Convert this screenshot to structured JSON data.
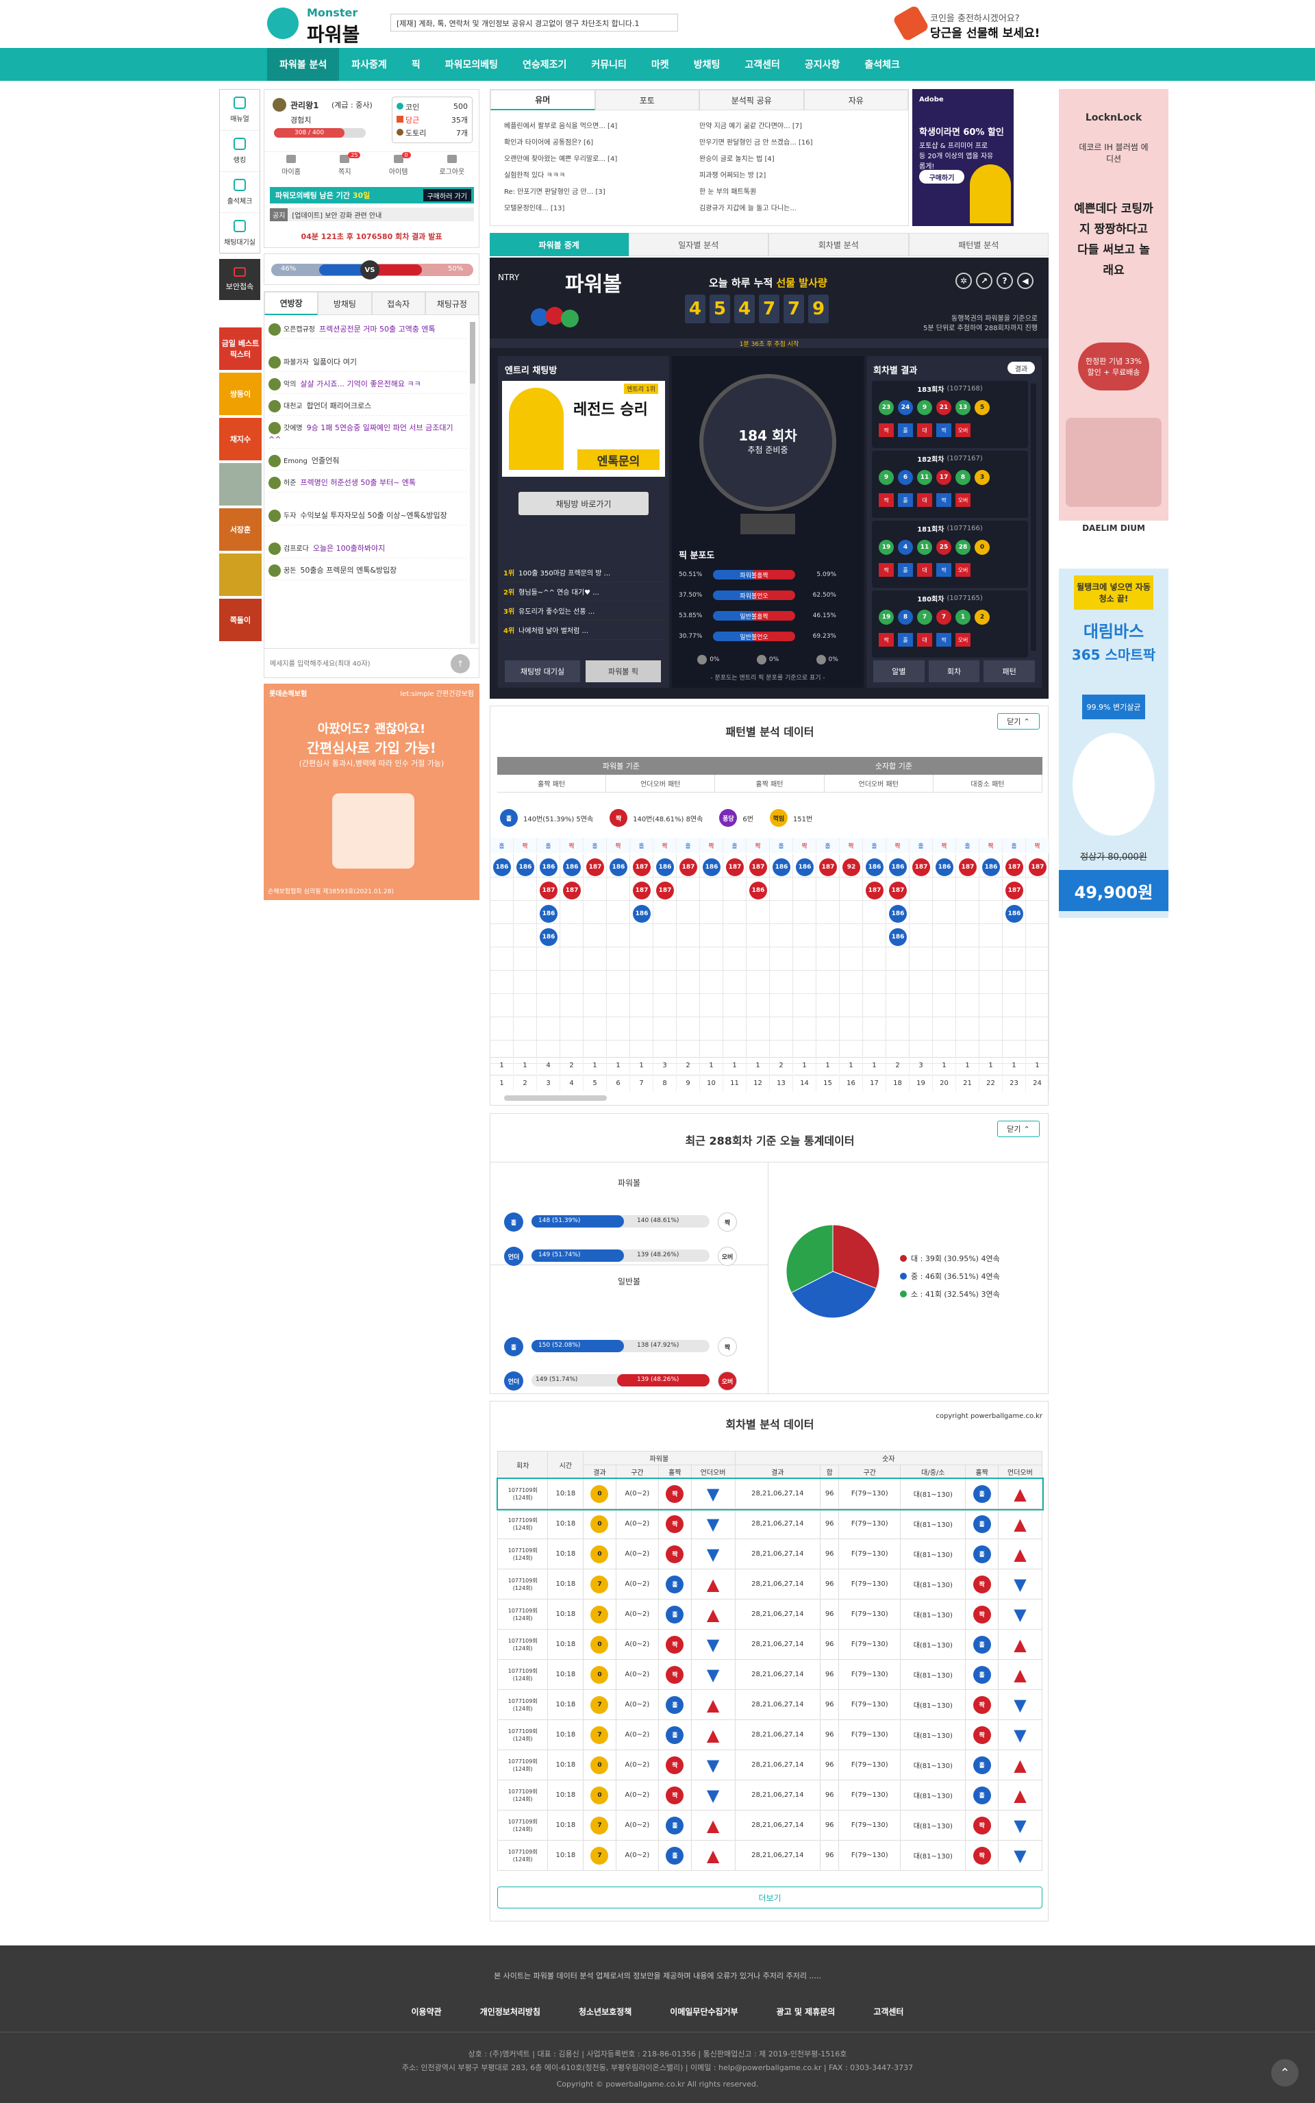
{
  "header": {
    "logo_small": "Monster",
    "logo_big": "파워볼",
    "notice": "[제재] 계좌, 톡, 연락처 및 개인정보 공유시 경고없이 영구 차단조치 합니다.1",
    "coin_line1": "코인을 충전하시겠어요?",
    "coin_line2": "당근을 선물해 보세요!"
  },
  "nav": [
    "파워볼 분석",
    "파사중계",
    "픽",
    "파워모의베팅",
    "연승제조기",
    "커뮤니티",
    "마켓",
    "방채팅",
    "고객센터",
    "공지사항",
    "출석체크"
  ],
  "sidebar_left": {
    "items": [
      "매뉴얼",
      "랭킹",
      "출석체크",
      "채팅대기실",
      "보안접속"
    ]
  },
  "profile": {
    "name": "관리왕1",
    "grade": "(계급 : 중사)",
    "exp_label": "경험치",
    "exp_value": "308 / 400",
    "coin_label": "코인",
    "coin_value": "500",
    "carrot_label": "당근",
    "carrot_value": "35개",
    "tool_label": "도토리",
    "tool_value": "7개",
    "links": [
      "마이홈",
      "쪽지",
      "아이템",
      "로그아웃"
    ],
    "msg_badge": "25",
    "item_badge": "0",
    "mock_label": "파워모의베팅 남은 기간",
    "mock_days": "30일",
    "mock_button": "구매하러 가기",
    "notice_tag": "공지",
    "notice_text": "[업데이트] 보안 강화 관련 안내",
    "round_info": "04분 121초 후 1076580 회차 결과 발표"
  },
  "vs_bar": {
    "left": "46%",
    "vs": "VS",
    "right": "50%"
  },
  "chat": {
    "tabs": [
      "연방장",
      "방채팅",
      "접속자",
      "채팅규정"
    ],
    "messages": [
      {
        "name": "오픈캡규정",
        "text": "프렉션공전문 거마 50출 고액충 엔톡"
      },
      {
        "name": "파볼가자",
        "text": "일품이다 여기"
      },
      {
        "name": "악의",
        "text": "살살 가시죠... 기억이 좋은전해요 ㅋㅋ"
      },
      {
        "name": "대천교",
        "text": "합언더 패리어크로스"
      },
      {
        "name": "갓에명",
        "text": "9승 1패 5연승중 일짜예인 파언 서브 금조대기 ^^"
      },
      {
        "name": "Emong",
        "text": "언줄언줘"
      },
      {
        "name": "허준",
        "text": "프렉명인 허준선생 50출 부터~ 엔톡"
      },
      {
        "name": "두자",
        "text": "수익보실 투자자모심 50출 이상~엔톡&방입장"
      },
      {
        "name": "검프로다",
        "text": "오늘은 100출하봐야지"
      },
      {
        "name": "꿈돈",
        "text": "50출승 프렉문의 엔톡&방입장"
      }
    ],
    "input_placeholder": "메세지를 입력해주세요(최대 40자)"
  },
  "left_ad": {
    "top_left": "롯데손해보험",
    "top_right": "let:simple 간편건강보험",
    "line1": "아팠어도? 괜찮아요!",
    "line2": "간편심사로 가입 가능!",
    "line3": "(간편심사 통과시,병력에 따라 인수 거절 가능)",
    "bottom": "손해보험협회 심의필 제38593호(2021.01.28)"
  },
  "left_promo": [
    "금일 베스트 픽스터",
    "쌍둥이",
    "채지수",
    "",
    "서장훈",
    "",
    "쪽돌이"
  ],
  "board": {
    "tabs": [
      "유머",
      "포토",
      "분석픽 공유",
      "자유"
    ],
    "left": [
      "베플린에서 팔부로 음식을 먹으면... [4]",
      "확인과 타이어에 공통점은? [6]",
      "오랜만에 찾아왔는 예쁜 우리말로... [4]",
      "실험한적 있다 ㅋㅋㅋ",
      "Re: 만포기면 판달형인 금 만... [3]",
      "모텔운정인데... [13]"
    ],
    "right": [
      "만약 지금 예기 굶같 간다면야... [7]",
      "만우기면 판달형인 금 안 쓰겠습... [16]",
      "완승이 글로 놀치는 법 [4]",
      "피과쟁 어쩌되는 방 [2]",
      "한 눈 부의 패트톡퀀",
      "김광규가 지갑에 늘 돌고 다니는..."
    ]
  },
  "adobe_ad": {
    "brand": "Adobe",
    "title": "학생이라면 60% 할인",
    "sub": "포토샵 & 프리미어 프로 등 20개 이상의 앱을 자유롭게!",
    "button": "구매하기"
  },
  "pb_tabs": [
    "파워볼 중계",
    "일자별 분석",
    "회차별 분석",
    "패턴별 분석"
  ],
  "pb_live": {
    "brand": "NTRY",
    "title": "파워볼",
    "today_label_prefix": "오늘 하루 누적",
    "today_label_highlight": "선물 발사량",
    "counter": [
      "4",
      "5",
      "4",
      "7",
      "7",
      "9"
    ],
    "note1": "동행복권의 파워볼을 기준으로",
    "note2": "5분 단위로 추첨하여 288회차까지 진행",
    "strip": "1분 36초 후 추첨 시작",
    "entry_title": "엔트리 채팅방",
    "entry_badge": "엔트리 1위",
    "entry_legend": "레전드 승리",
    "entry_sub": "엔톡문의",
    "entry_button": "채팅방 바로가기",
    "round_no": "184 회차",
    "round_state": "추첨 준비중",
    "pick_title": "픽 분포도",
    "ranks": [
      {
        "rank": "1위",
        "text": "100출 350마감 프렉문의 방 ..."
      },
      {
        "rank": "2위",
        "text": "형님들~^^ 연승 대기♥ ..."
      },
      {
        "rank": "3위",
        "text": "유도리가 좋수있는 선풍 ..."
      },
      {
        "rank": "4위",
        "text": "나에처럼 날아 벌처럼 ..."
      }
    ],
    "dist": [
      {
        "left": "50.51%",
        "label": "파워볼홀짝",
        "right": "5.09%"
      },
      {
        "left": "37.50%",
        "label": "파워볼언오",
        "right": "62.50%"
      },
      {
        "left": "53.85%",
        "label": "일반볼홀짝",
        "right": "46.15%"
      },
      {
        "left": "30.77%",
        "label": "일반볼언오",
        "right": "69.23%"
      }
    ],
    "zeros": [
      "0%",
      "0%",
      "0%"
    ],
    "note": "- 분포도는 엔트리 픽 분포를 기준으로 표기 -",
    "btn_wait": "채팅방 대기실",
    "btn_pick": "파워볼 픽",
    "results_title": "회차별 결과",
    "results_more": "결과",
    "results": [
      {
        "title": "183회차",
        "sub": "(1077168)",
        "nums": [
          "23",
          "24",
          "9",
          "21",
          "13",
          "5"
        ]
      },
      {
        "title": "182회차",
        "sub": "(1077167)",
        "nums": [
          "9",
          "6",
          "11",
          "17",
          "8",
          "3"
        ]
      },
      {
        "title": "181회차",
        "sub": "(1077166)",
        "nums": [
          "19",
          "4",
          "11",
          "25",
          "28",
          "0"
        ]
      },
      {
        "title": "180회차",
        "sub": "(1077165)",
        "nums": [
          "19",
          "8",
          "7",
          "7",
          "1",
          "2"
        ]
      }
    ],
    "tags": [
      "짝",
      "홀",
      "대",
      "짝",
      "오버"
    ],
    "bottom_btns": [
      "알별",
      "회차",
      "패턴"
    ]
  },
  "pattern": {
    "title": "패턴별 분석 데이터",
    "close": "닫기",
    "head1": "파워볼 기준",
    "head2": "숫자합 기준",
    "sub": [
      "홀짝 패턴",
      "언더오버 패턴",
      "홀짝 패턴",
      "언더오버 패턴",
      "대중소 패턴"
    ],
    "stat_odd": "140번(51.39%) 5연속",
    "stat_even": "140번(48.61%) 8연속",
    "stat_rev": "6번",
    "stat_rev_label": "퐁당",
    "stat_conv": "151번",
    "stat_conv_label": "꺽임",
    "odd": "홀",
    "even": "짝",
    "top_row": [
      "186",
      "186",
      "186",
      "186",
      "187",
      "186",
      "187",
      "186",
      "187",
      "186",
      "187",
      "187",
      "186",
      "186",
      "187",
      "92",
      "186",
      "186",
      "187",
      "186",
      "187",
      "186",
      "187",
      "187",
      "187"
    ],
    "sums": [
      "1",
      "1",
      "4",
      "2",
      "1",
      "1",
      "1",
      "3",
      "2",
      "1",
      "1",
      "1",
      "2",
      "1",
      "1",
      "1",
      "1",
      "2",
      "3",
      "1",
      "1",
      "1",
      "1",
      "1",
      "1"
    ],
    "idx": [
      "1",
      "2",
      "3",
      "4",
      "5",
      "6",
      "7",
      "8",
      "9",
      "10",
      "11",
      "12",
      "13",
      "14",
      "15",
      "16",
      "17",
      "18",
      "19",
      "20",
      "21",
      "22",
      "23",
      "24"
    ]
  },
  "stats288": {
    "title": "최근 288회차 기준 오늘 통계데이터",
    "close": "닫기",
    "pb_title": "파워볼",
    "nb_title": "일반볼",
    "rows": [
      {
        "lbl": "홀",
        "left": "148 (51.39%)",
        "right": "140 (48.61%)",
        "rlbl": "짝"
      },
      {
        "lbl": "언더",
        "left": "149 (51.74%)",
        "right": "139 (48.26%)",
        "rlbl": "오버"
      },
      {
        "lbl": "홀",
        "left": "150 (52.08%)",
        "right": "138 (47.92%)",
        "rlbl": "짝"
      },
      {
        "lbl": "언더",
        "left": "149 (51.74%)",
        "right": "139 (48.26%)",
        "rlbl": "오버"
      }
    ],
    "legend": [
      {
        "label": "대 : 39회 (30.95%) 4연속",
        "color": "#c0242c"
      },
      {
        "label": "중 : 46회 (36.51%) 4연속",
        "color": "#1e5fc4"
      },
      {
        "label": "소 : 41회 (32.54%) 3연속",
        "color": "#2aa34a"
      }
    ]
  },
  "chart_data": {
    "type": "pie",
    "categories": [
      "대",
      "중",
      "소"
    ],
    "values": [
      30.95,
      36.51,
      32.54
    ],
    "colors": [
      "#c0242c",
      "#1e5fc4",
      "#2aa34a"
    ]
  },
  "round_table": {
    "title": "회차별 분석 데이터",
    "copyright": "copyright powerballgame.co.kr",
    "heads": [
      "회차",
      "시간",
      "결과",
      "구간",
      "홀짝",
      "언더오버",
      "결과",
      "합",
      "구간",
      "대/중/소",
      "홀짝",
      "언더오버"
    ],
    "group1": "파워볼",
    "group2": "숫자",
    "rows": [
      {
        "round": "1077109회",
        "sub": "(124회)",
        "time": "10:18",
        "res": "0",
        "zone": "A(0~2)",
        "oe": "짝",
        "uo": "down",
        "nums": "28,21,06,27,14",
        "sum": "96",
        "zone2": "F(79~130)",
        "size": "대(81~130)",
        "oe2": "홀",
        "uo2": "up"
      },
      {
        "round": "1077109회",
        "sub": "(124회)",
        "time": "10:18",
        "res": "0",
        "zone": "A(0~2)",
        "oe": "짝",
        "uo": "down",
        "nums": "28,21,06,27,14",
        "sum": "96",
        "zone2": "F(79~130)",
        "size": "대(81~130)",
        "oe2": "홀",
        "uo2": "up"
      },
      {
        "round": "1077109회",
        "sub": "(124회)",
        "time": "10:18",
        "res": "0",
        "zone": "A(0~2)",
        "oe": "짝",
        "uo": "down",
        "nums": "28,21,06,27,14",
        "sum": "96",
        "zone2": "F(79~130)",
        "size": "대(81~130)",
        "oe2": "홀",
        "uo2": "up"
      },
      {
        "round": "1077109회",
        "sub": "(124회)",
        "time": "10:18",
        "res": "7",
        "zone": "A(0~2)",
        "oe": "홀",
        "uo": "up",
        "nums": "28,21,06,27,14",
        "sum": "96",
        "zone2": "F(79~130)",
        "size": "대(81~130)",
        "oe2": "짝",
        "uo2": "down"
      },
      {
        "round": "1077109회",
        "sub": "(124회)",
        "time": "10:18",
        "res": "7",
        "zone": "A(0~2)",
        "oe": "홀",
        "uo": "up",
        "nums": "28,21,06,27,14",
        "sum": "96",
        "zone2": "F(79~130)",
        "size": "대(81~130)",
        "oe2": "짝",
        "uo2": "down"
      },
      {
        "round": "1077109회",
        "sub": "(124회)",
        "time": "10:18",
        "res": "0",
        "zone": "A(0~2)",
        "oe": "짝",
        "uo": "down",
        "nums": "28,21,06,27,14",
        "sum": "96",
        "zone2": "F(79~130)",
        "size": "대(81~130)",
        "oe2": "홀",
        "uo2": "up"
      },
      {
        "round": "1077109회",
        "sub": "(124회)",
        "time": "10:18",
        "res": "0",
        "zone": "A(0~2)",
        "oe": "짝",
        "uo": "down",
        "nums": "28,21,06,27,14",
        "sum": "96",
        "zone2": "F(79~130)",
        "size": "대(81~130)",
        "oe2": "홀",
        "uo2": "up"
      },
      {
        "round": "1077109회",
        "sub": "(124회)",
        "time": "10:18",
        "res": "7",
        "zone": "A(0~2)",
        "oe": "홀",
        "uo": "up",
        "nums": "28,21,06,27,14",
        "sum": "96",
        "zone2": "F(79~130)",
        "size": "대(81~130)",
        "oe2": "짝",
        "uo2": "down"
      },
      {
        "round": "1077109회",
        "sub": "(124회)",
        "time": "10:18",
        "res": "7",
        "zone": "A(0~2)",
        "oe": "홀",
        "uo": "up",
        "nums": "28,21,06,27,14",
        "sum": "96",
        "zone2": "F(79~130)",
        "size": "대(81~130)",
        "oe2": "짝",
        "uo2": "down"
      },
      {
        "round": "1077109회",
        "sub": "(124회)",
        "time": "10:18",
        "res": "0",
        "zone": "A(0~2)",
        "oe": "짝",
        "uo": "down",
        "nums": "28,21,06,27,14",
        "sum": "96",
        "zone2": "F(79~130)",
        "size": "대(81~130)",
        "oe2": "홀",
        "uo2": "up"
      },
      {
        "round": "1077109회",
        "sub": "(124회)",
        "time": "10:18",
        "res": "0",
        "zone": "A(0~2)",
        "oe": "짝",
        "uo": "down",
        "nums": "28,21,06,27,14",
        "sum": "96",
        "zone2": "F(79~130)",
        "size": "대(81~130)",
        "oe2": "홀",
        "uo2": "up"
      },
      {
        "round": "1077109회",
        "sub": "(124회)",
        "time": "10:18",
        "res": "7",
        "zone": "A(0~2)",
        "oe": "홀",
        "uo": "up",
        "nums": "28,21,06,27,14",
        "sum": "96",
        "zone2": "F(79~130)",
        "size": "대(81~130)",
        "oe2": "짝",
        "uo2": "down"
      },
      {
        "round": "1077109회",
        "sub": "(124회)",
        "time": "10:18",
        "res": "7",
        "zone": "A(0~2)",
        "oe": "홀",
        "uo": "up",
        "nums": "28,21,06,27,14",
        "sum": "96",
        "zone2": "F(79~130)",
        "size": "대(81~130)",
        "oe2": "짝",
        "uo2": "down"
      }
    ],
    "more": "더보기"
  },
  "right_ads": {
    "ad1_brand": "LocknLock",
    "ad1_sub": "데코르 IH 블러썸 에디션",
    "ad1_quote": "예쁜데다 코팅까지 짱짱하다고 다들 써보고 놀래요",
    "ad1_promo": "한정판 기념 33% 할인 + 무료배송",
    "ad2_brand": "DAELIM DIUM",
    "ad2_line1": "뒬탱크에 넣으면 자동청소 끝!",
    "ad2_line2": "대림바스",
    "ad2_line3": "365 스마트팍",
    "ad2_line4": "99.9% 변기살균",
    "ad2_old": "정상가 80,000원",
    "ad2_price": "49,900원"
  },
  "footer": {
    "notice": "본 사이트는 파워볼 데이터 분석 업체로서의 정보만을 제공하며 내용에 오류가 있거나 주저리 주저리 .....",
    "links": [
      "이용약관",
      "개인정보처리방침",
      "청소년보호정책",
      "이메일무단수집거부",
      "광고 및 제휴문의",
      "고객센터"
    ],
    "info1": "상호 : (주)엠커넥트 | 대표 : 김용신 | 사업자등록번호 : 218-86-01356 | 통신판매업신고 : 제 2019-인천부평-1516호",
    "info2": "주소: 인천광역시 부평구 부평대로 283, 6층 에이-610호(청천동, 부평우림라이온스밸리) | 이메일 : help@powerballgame.co.kr | FAX : 0303-3447-3737",
    "copy": "Copyright © powerballgame.co.kr All rights reserved."
  }
}
